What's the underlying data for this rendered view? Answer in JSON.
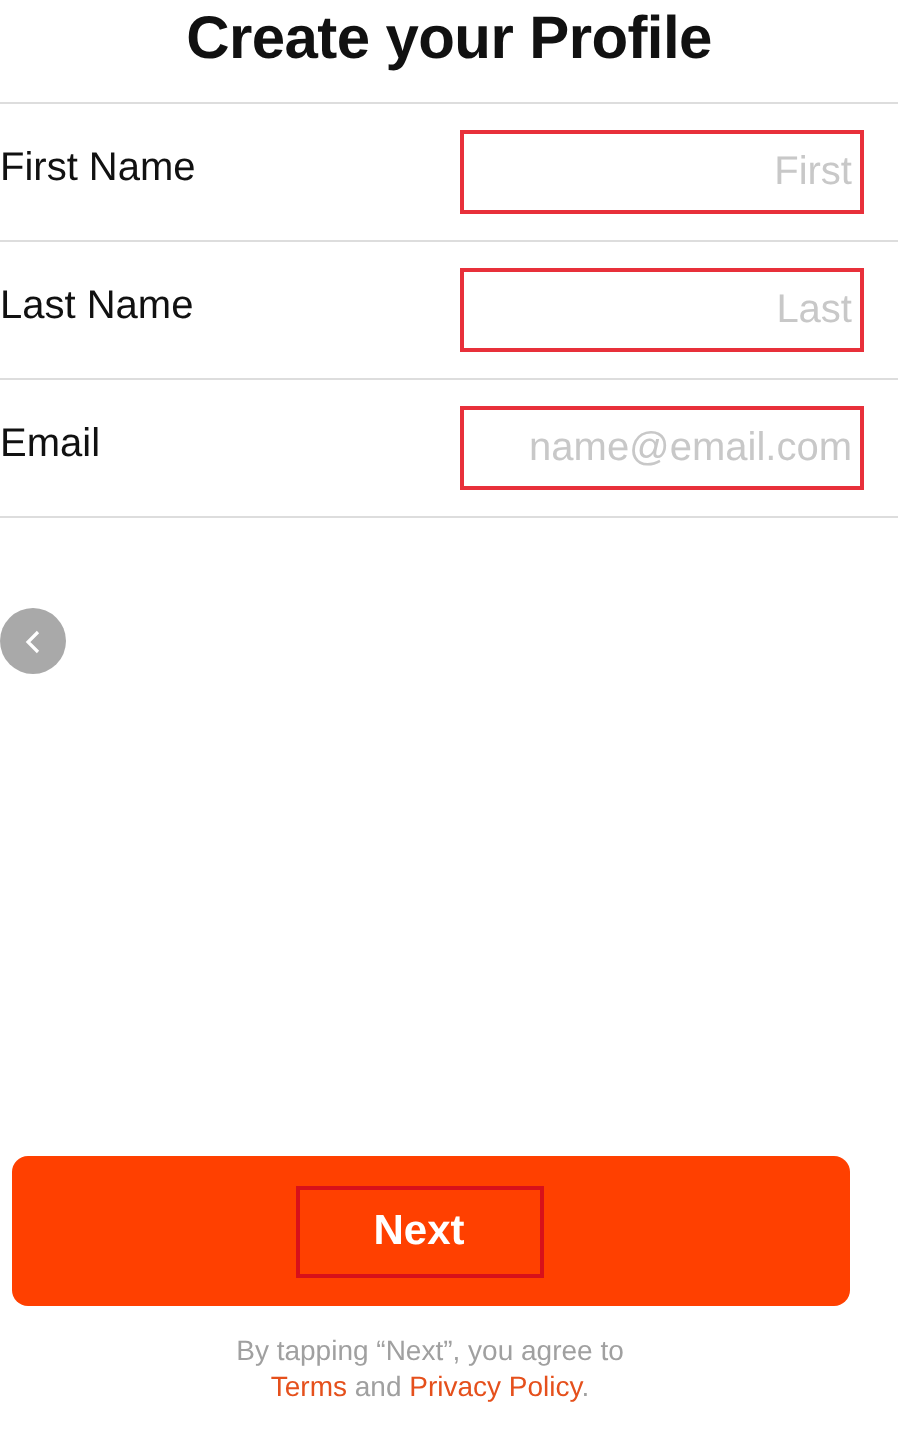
{
  "title": "Create your Profile",
  "fields": [
    {
      "label": "First Name",
      "placeholder": "First",
      "highlighted": true
    },
    {
      "label": "Last Name",
      "placeholder": "Last",
      "highlighted": true
    },
    {
      "label": "Email",
      "placeholder": "name@email.com",
      "highlighted": true
    }
  ],
  "next_button": {
    "label": "Next",
    "highlighted": true
  },
  "agreement": {
    "line": "By tapping “Next”, you agree to",
    "terms_link": "Terms",
    "conjunction": "and",
    "policy_link": "Privacy Policy",
    "end": "."
  }
}
